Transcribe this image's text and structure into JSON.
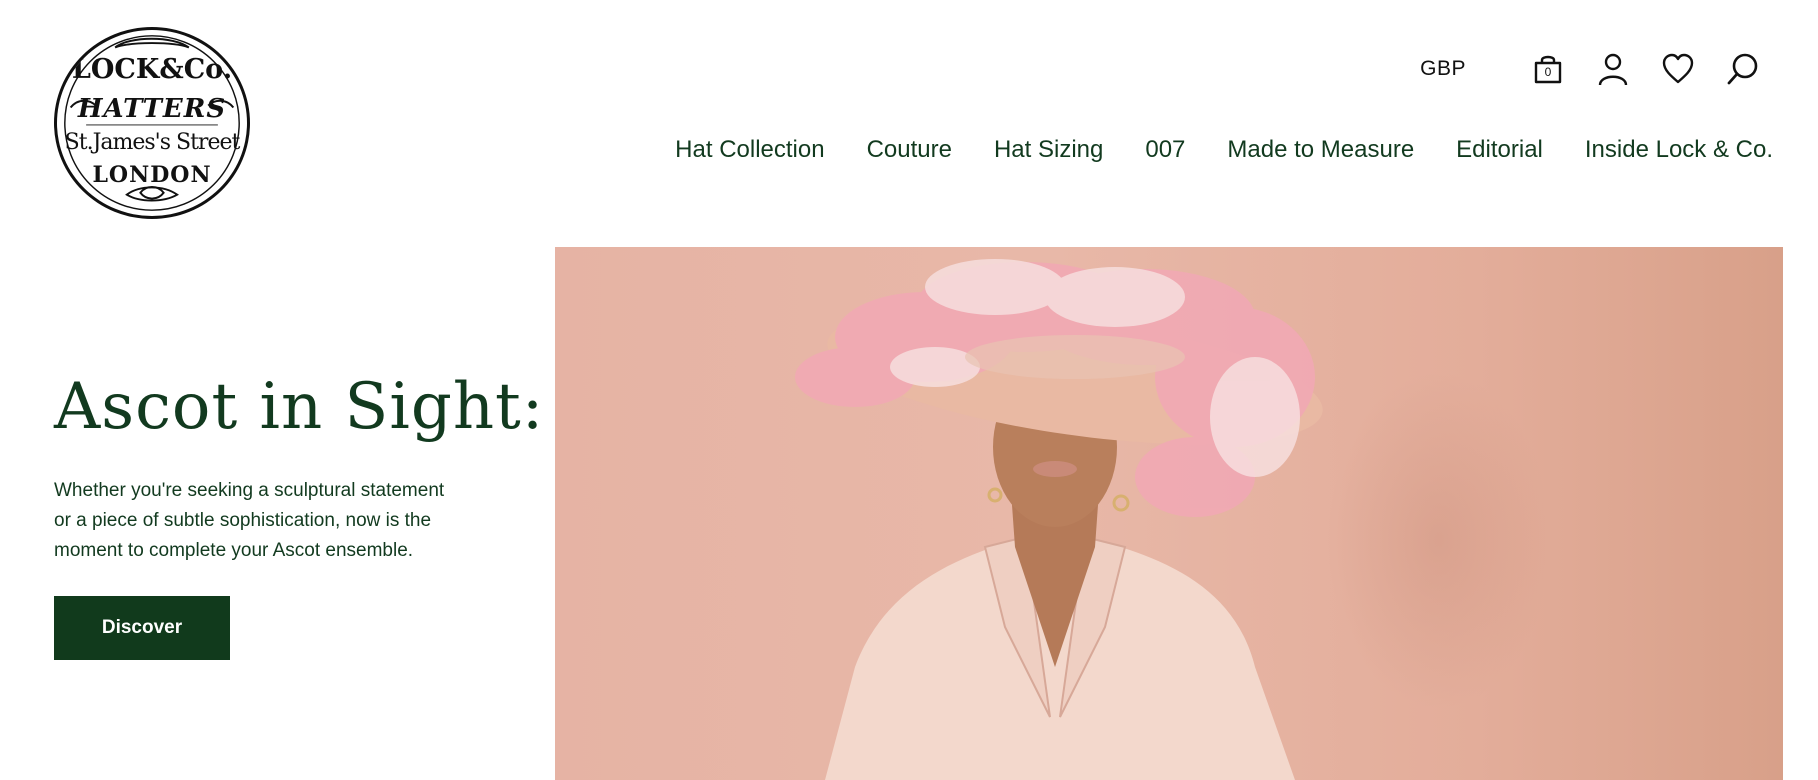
{
  "brand": {
    "logo_line1": "LOCK&Co.",
    "logo_line2": "HATTERS",
    "logo_line3": "St.James's Street",
    "logo_line4": "LONDON"
  },
  "utility": {
    "currency": "GBP",
    "bag_count": "0",
    "icons": [
      "shopping-bag-icon",
      "account-icon",
      "wishlist-heart-icon",
      "search-icon"
    ]
  },
  "nav": {
    "items": [
      {
        "label": "Hat Collection"
      },
      {
        "label": "Couture"
      },
      {
        "label": "Hat Sizing"
      },
      {
        "label": "007"
      },
      {
        "label": "Made to Measure"
      },
      {
        "label": "Editorial"
      },
      {
        "label": "Inside Lock & Co."
      }
    ]
  },
  "hero": {
    "title": "Ascot in Sight:",
    "description": "Whether you're seeking a sculptural statement or a piece of subtle sophistication, now is the moment to complete your Ascot ensemble.",
    "button_label": "Discover"
  },
  "colors": {
    "brand_green": "#123a1f",
    "button_green": "#113a1c",
    "photo_background": "#e6b3a4"
  }
}
